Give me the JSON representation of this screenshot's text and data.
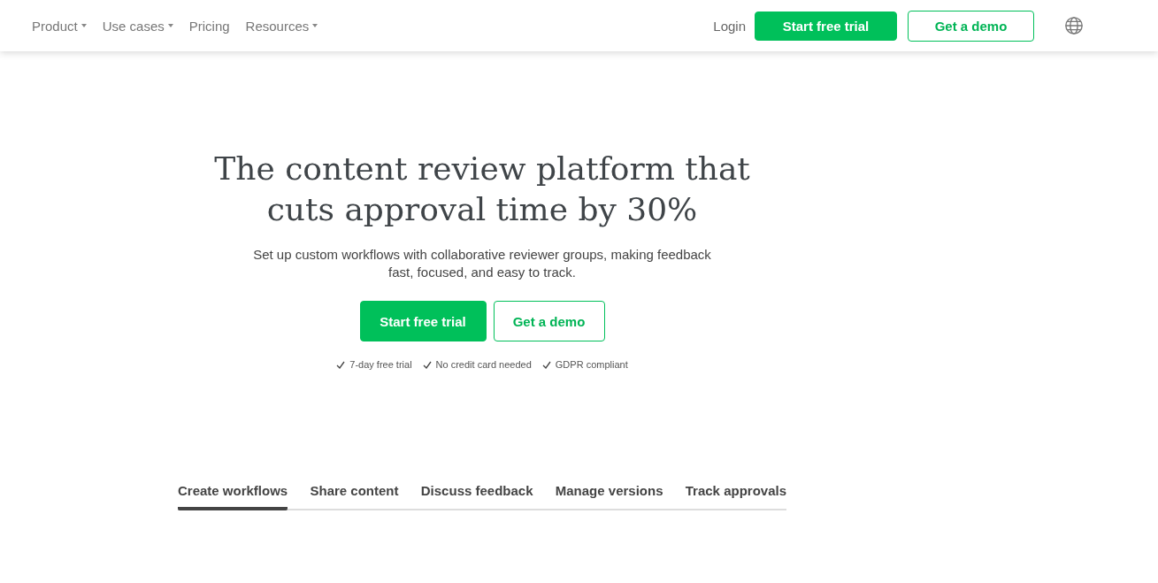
{
  "nav": {
    "menu": [
      {
        "label": "Product",
        "dropdown": true
      },
      {
        "label": "Use cases",
        "dropdown": true
      },
      {
        "label": "Pricing",
        "dropdown": false
      },
      {
        "label": "Resources",
        "dropdown": true
      }
    ],
    "login": "Login",
    "primary": "Start free trial",
    "secondary": "Get a demo"
  },
  "hero": {
    "title": "The content review platform that cuts approval time by 30%",
    "subtitle": "Set up custom workflows with collaborative reviewer groups, making feedback fast, focused, and easy to track.",
    "primary": "Start free trial",
    "secondary": "Get a demo",
    "perks": [
      "7-day free trial",
      "No credit card needed",
      "GDPR compliant"
    ]
  },
  "tabs": [
    {
      "label": "Create workflows",
      "selected": true
    },
    {
      "label": "Share content",
      "selected": false
    },
    {
      "label": "Discuss feedback",
      "selected": false
    },
    {
      "label": "Manage versions",
      "selected": false
    },
    {
      "label": "Track approvals",
      "selected": false
    }
  ]
}
